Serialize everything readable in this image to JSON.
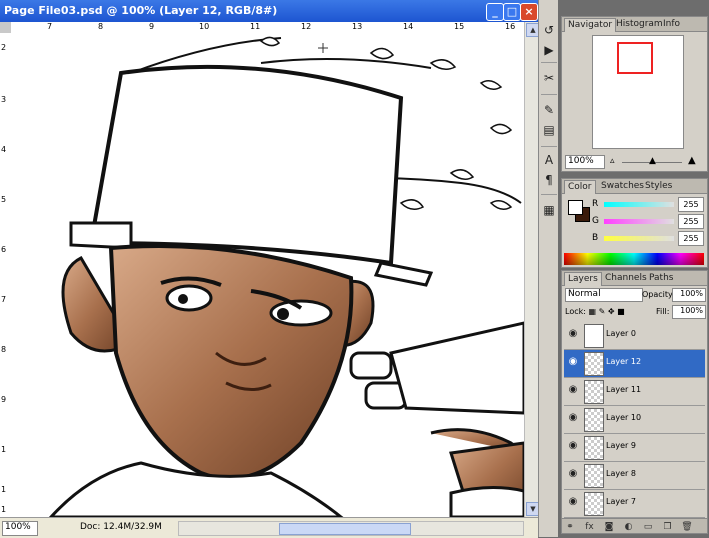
{
  "document": {
    "title": "Page File03.psd @ 100% (Layer 12, RGB/8#)",
    "ruler_h": [
      "7",
      "8",
      "9",
      "10",
      "11",
      "12",
      "13",
      "14",
      "15",
      "16"
    ],
    "ruler_v": [
      "2",
      "3",
      "4",
      "5",
      "6",
      "7",
      "8",
      "9",
      "1",
      "1",
      "1"
    ],
    "status": {
      "zoom": "100%",
      "doc": "Doc: 12.4M/32.9M"
    }
  },
  "navigator": {
    "tabs": [
      "Navigator",
      "Histogram",
      "Info"
    ],
    "zoom": "100%"
  },
  "color": {
    "tabs": [
      "Color",
      "Swatches",
      "Styles"
    ],
    "channels": [
      {
        "label": "R",
        "value": "255",
        "bar": "#00e0e0"
      },
      {
        "label": "G",
        "value": "255",
        "bar": "#e040e0"
      },
      {
        "label": "B",
        "value": "255",
        "bar": "#e0e000"
      }
    ],
    "fg": "#ffffff",
    "bg": "#3a1a0a"
  },
  "layers": {
    "tabs": [
      "Layers",
      "Channels",
      "Paths"
    ],
    "blend_mode": "Normal",
    "opacity_label": "Opacity:",
    "opacity": "100%",
    "lock_label": "Lock:",
    "fill_label": "Fill:",
    "fill": "100%",
    "items": [
      {
        "name": "Layer 0"
      },
      {
        "name": "Layer 12",
        "selected": true
      },
      {
        "name": "Layer 11"
      },
      {
        "name": "Layer 10"
      },
      {
        "name": "Layer 9"
      },
      {
        "name": "Layer 8"
      },
      {
        "name": "Layer 7"
      }
    ]
  }
}
